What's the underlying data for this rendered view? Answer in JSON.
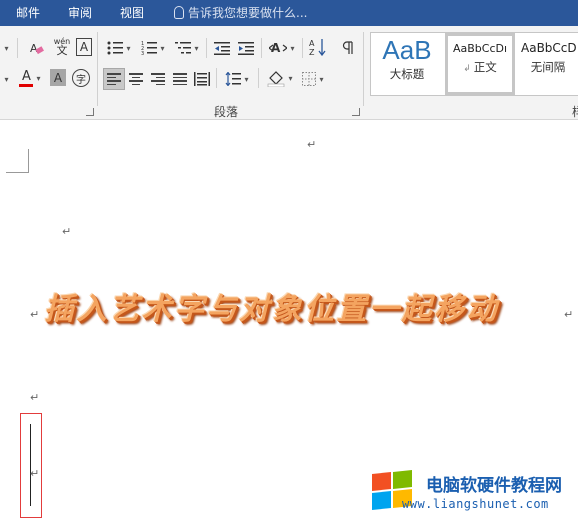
{
  "menu": {
    "tabs": [
      "邮件",
      "审阅",
      "视图"
    ],
    "tell_me": "告诉我您想要做什么..."
  },
  "ribbon": {
    "font": {
      "phonetic_top": "wén",
      "phonetic_bottom": "文",
      "char_border": "A",
      "font_color": "A",
      "char_shading": "A",
      "enclose_char": "字"
    },
    "paragraph": {
      "group_label": "段落"
    },
    "styles": [
      {
        "sample": "AaB",
        "name": "大标题"
      },
      {
        "sample": "AaBbCcDı",
        "name": "正文"
      },
      {
        "sample": "AaBbCcD",
        "name": "无间隔"
      }
    ],
    "styles_group_partial": "样"
  },
  "document": {
    "paragraph_mark": "↵",
    "wordart_text": "插入艺术字与对象位置一起移动"
  },
  "watermark": {
    "title": "电脑软硬件教程网",
    "url": "www.liangshunet.com",
    "colors": {
      "red": "#f25022",
      "green": "#7fba00",
      "blue": "#00a4ef",
      "yellow": "#ffb900"
    }
  },
  "colors": {
    "menu_bar": "#2b579a",
    "ribbon_bg": "#f3f3f3",
    "wordart_fill": "#f4a460",
    "wordart_shadow": "#c4571b",
    "red_box": "#e23c3c",
    "font_color_bar": "#e00000"
  }
}
